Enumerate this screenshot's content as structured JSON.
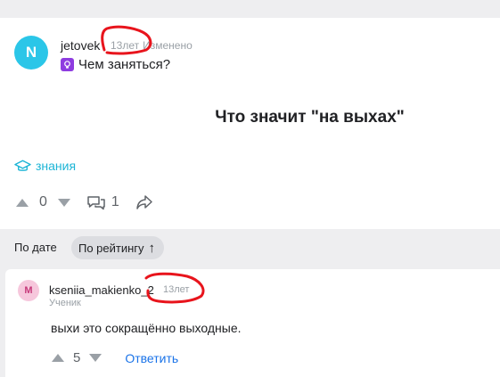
{
  "question": {
    "avatar_letter": "N",
    "author": "jetovek",
    "time": "13лет",
    "edited": "Изменено",
    "category": "Чем заняться?",
    "title": "Что значит \"на выхах\"",
    "tag": "знания",
    "votes": "0",
    "comments": "1",
    "icons": [
      "lightbulb-icon",
      "graduation-cap-icon",
      "comment-icon",
      "share-icon"
    ]
  },
  "sort": {
    "by_date": "По дате",
    "by_rating": "По рейтингу",
    "rating_arrow": "↑"
  },
  "answer": {
    "avatar_letter": "M",
    "author": "kseniia_makienko_2",
    "time": "13лет",
    "role": "Ученик",
    "text": "выхи это сокращённо выходные.",
    "votes": "5",
    "reply": "Ответить"
  },
  "colors": {
    "question_avatar": "#2bc6e8",
    "answer_avatar": "#f6c7dc",
    "tag": "#1db5d6",
    "link": "#1a73e8",
    "annotation": "#e8141c"
  }
}
